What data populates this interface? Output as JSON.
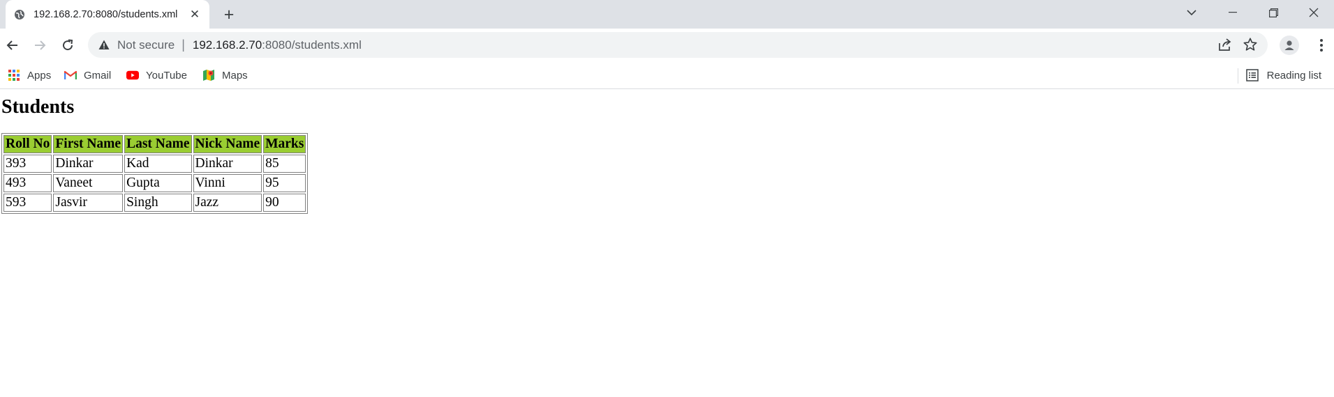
{
  "browser": {
    "tab_title": "192.168.2.70:8080/students.xml",
    "omnibox": {
      "security_label": "Not secure",
      "separator": "|",
      "url_host": "192.168.2.70",
      "url_rest": ":8080/students.xml"
    },
    "bookmarks": [
      {
        "label": "Apps",
        "icon": "apps-grid-icon"
      },
      {
        "label": "Gmail",
        "icon": "gmail-icon"
      },
      {
        "label": "YouTube",
        "icon": "youtube-icon"
      },
      {
        "label": "Maps",
        "icon": "maps-icon"
      }
    ],
    "reading_list_label": "Reading list"
  },
  "page": {
    "heading": "Students",
    "table": {
      "header_color": "#9acd32",
      "columns": [
        "Roll No",
        "First Name",
        "Last Name",
        "Nick Name",
        "Marks"
      ],
      "rows": [
        [
          "393",
          "Dinkar",
          "Kad",
          "Dinkar",
          "85"
        ],
        [
          "493",
          "Vaneet",
          "Gupta",
          "Vinni",
          "95"
        ],
        [
          "593",
          "Jasvir",
          "Singh",
          "Jazz",
          "90"
        ]
      ]
    }
  }
}
